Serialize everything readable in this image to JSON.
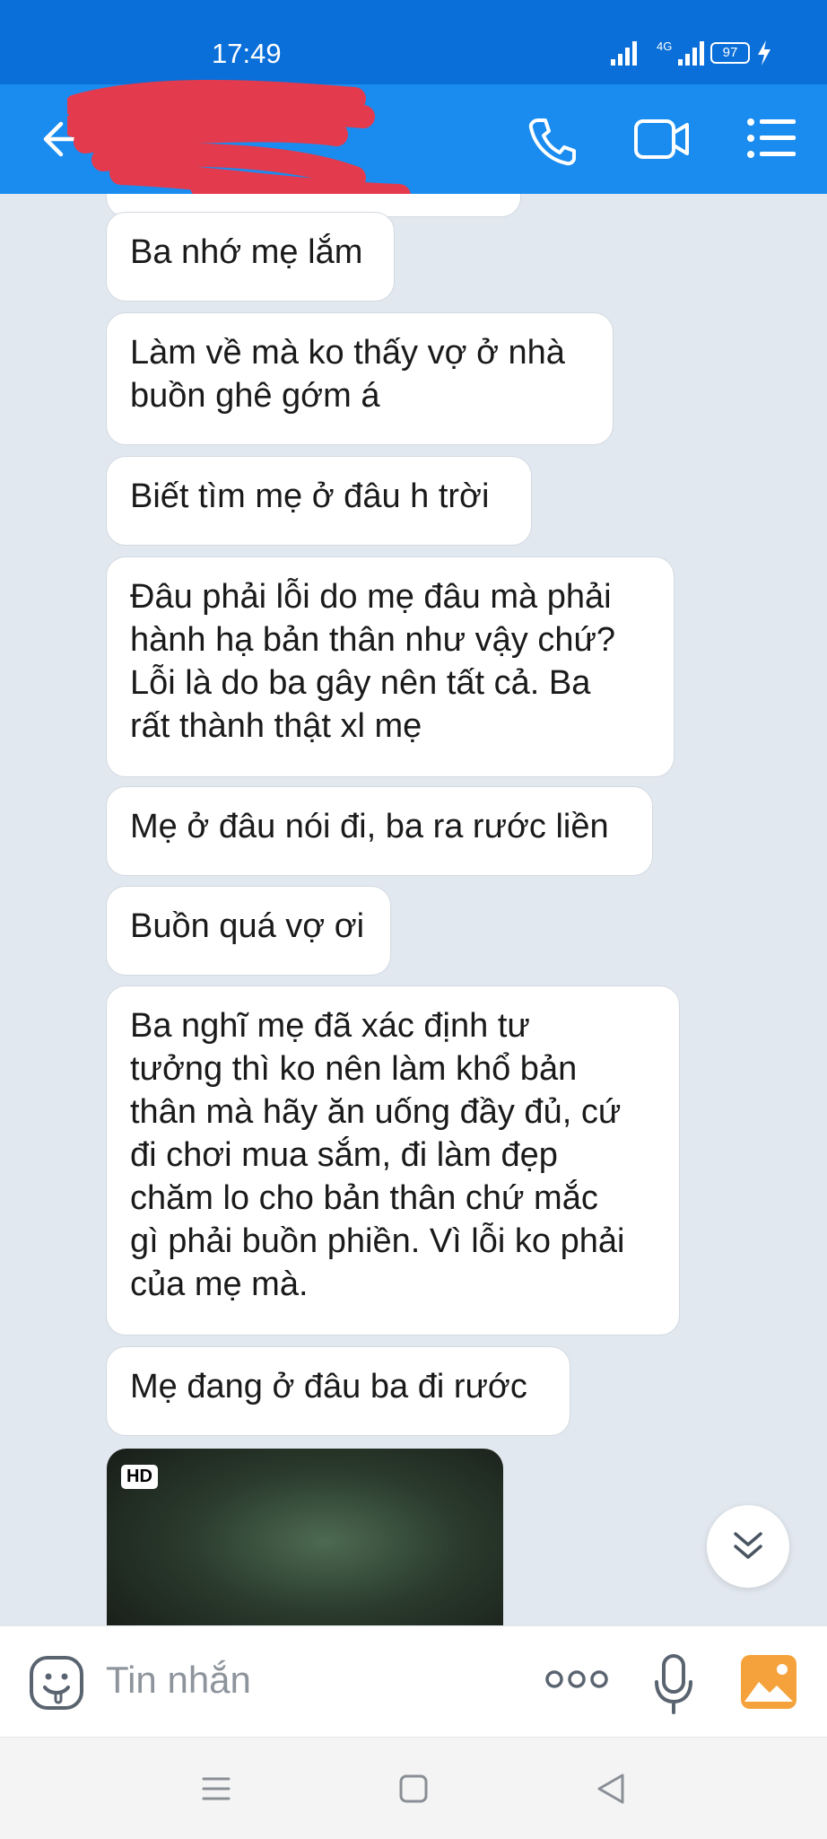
{
  "status_bar": {
    "time": "17:49",
    "network": "4G",
    "battery": "97"
  },
  "header": {
    "contact_name": ""
  },
  "messages": [
    "Ba nhớ mẹ lắm",
    "Làm về mà ko thấy vợ ở nhà\nbuồn ghê gớm á",
    "Biết tìm mẹ ở đâu h trời",
    "Đâu phải lỗi do mẹ đâu mà phải\nhành hạ bản thân như vậy chứ?\nLỗi là do ba gây nên tất cả. Ba\nrất thành thật xl mẹ",
    "Mẹ ở đâu nói đi, ba ra rước liền",
    "Buồn quá vợ ơi",
    "Ba nghĩ mẹ đã xác định tư\ntưởng thì ko nên làm khổ bản\nthân mà hãy ăn uống đầy đủ, cứ\nđi chơi mua sắm, đi làm đẹp\nchăm lo cho bản thân chứ mắc\ngì phải buồn phiền. Vì lỗi ko phải\ncủa mẹ mà.",
    "Mẹ đang ở đâu ba đi rước"
  ],
  "media": {
    "badge": "HD"
  },
  "input": {
    "placeholder": "Tin nhắn"
  },
  "colors": {
    "status_bar": "#0a6fd8",
    "header": "#1a8cf0",
    "chat_background": "#e2e8ef",
    "redaction": "#e33a4d",
    "gallery_icon": "#f5a23c"
  }
}
